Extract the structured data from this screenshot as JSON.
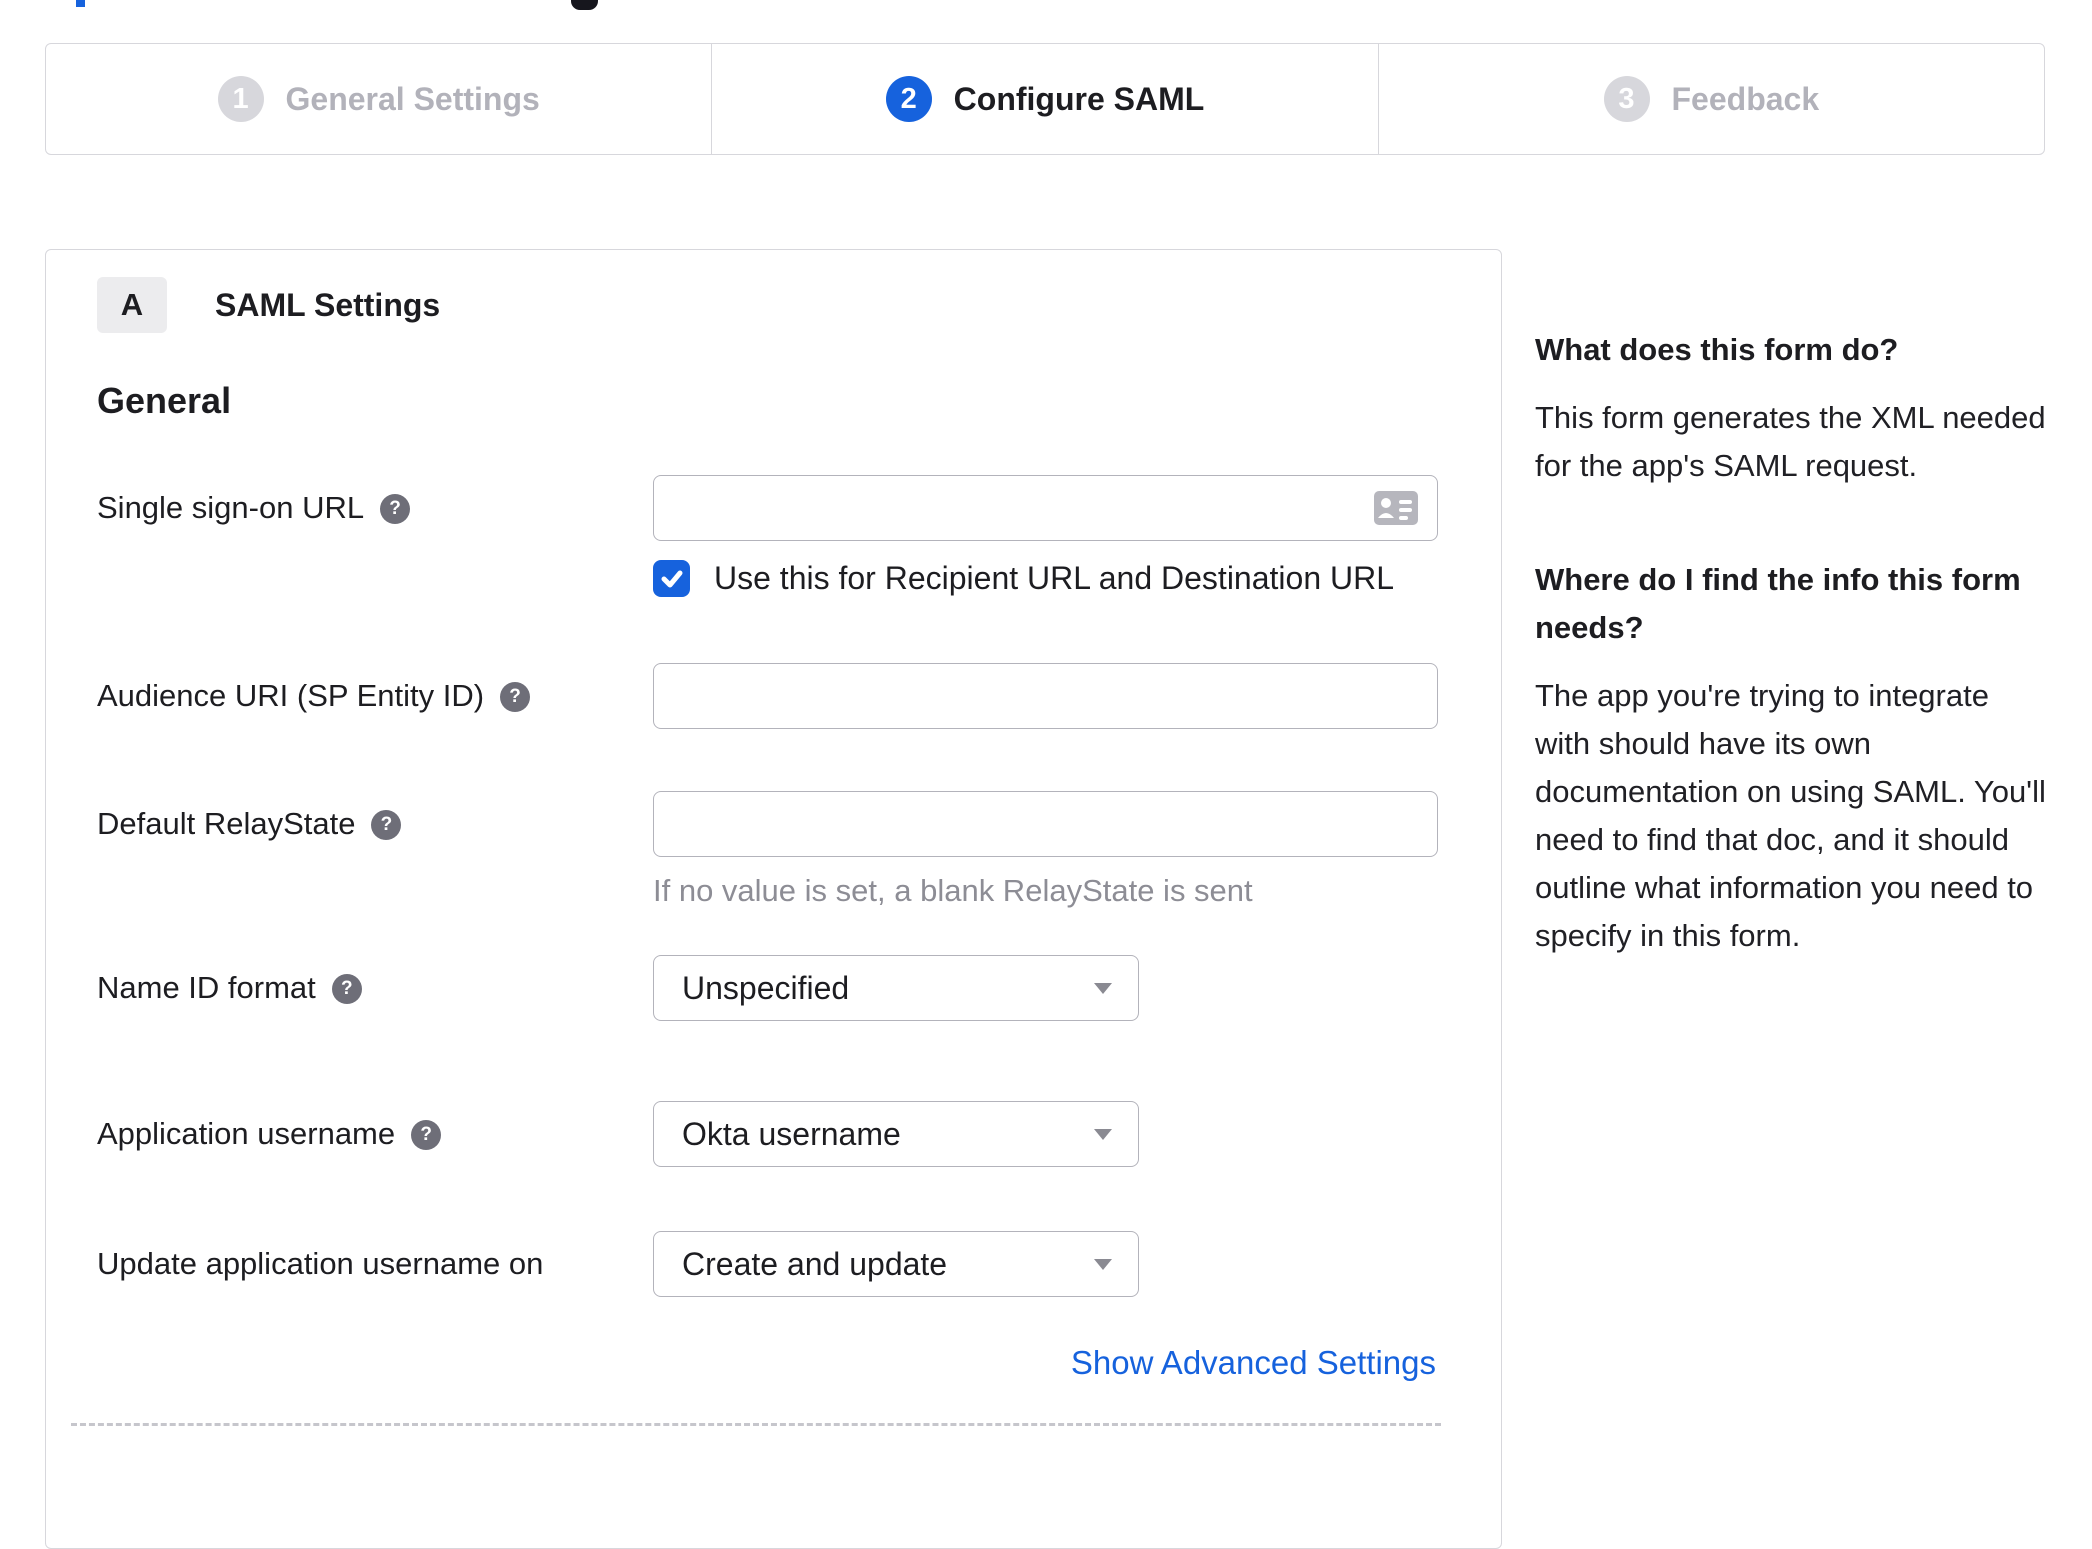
{
  "colors": {
    "accent": "#1662dd",
    "panel_border": "#d7d7dc",
    "input_border": "#b3b3bb",
    "text": "#1d1d21",
    "inactive_step": "#b2b2ba",
    "muted": "#8d8d95",
    "help_icon_bg": "#6e6e78"
  },
  "icons": {
    "help_glyph": "?",
    "sso_input_icon": "contact-card-icon",
    "checkbox_icon": "checkmark-icon",
    "select_icon": "caret-down-icon"
  },
  "stepper": {
    "steps": [
      {
        "number": "1",
        "label": "General Settings",
        "state": "inactive"
      },
      {
        "number": "2",
        "label": "Configure SAML",
        "state": "active"
      },
      {
        "number": "3",
        "label": "Feedback",
        "state": "inactive"
      }
    ]
  },
  "panel": {
    "badge": "A",
    "title": "SAML Settings",
    "section": "General",
    "form": {
      "sso": {
        "label": "Single sign-on URL",
        "value": "",
        "checkbox_checked": true,
        "checkbox_label": "Use this for Recipient URL and Destination URL"
      },
      "audience": {
        "label": "Audience URI (SP Entity ID)",
        "value": ""
      },
      "relay": {
        "label": "Default RelayState",
        "value": "",
        "hint": "If no value is set, a blank RelayState is sent"
      },
      "name_id": {
        "label": "Name ID format",
        "value": "Unspecified"
      },
      "app_username": {
        "label": "Application username",
        "value": "Okta username"
      },
      "update_username": {
        "label": "Update application username on",
        "value": "Create and update"
      },
      "advanced_link": "Show Advanced Settings"
    }
  },
  "sidebar": {
    "sections": [
      {
        "heading": "What does this form do?",
        "body": "This form generates the XML needed for the app's SAML request."
      },
      {
        "heading": "Where do I find the info this form needs?",
        "body": "The app you're trying to integrate with should have its own documentation on using SAML. You'll need to find that doc, and it should outline what information you need to specify in this form."
      }
    ]
  }
}
